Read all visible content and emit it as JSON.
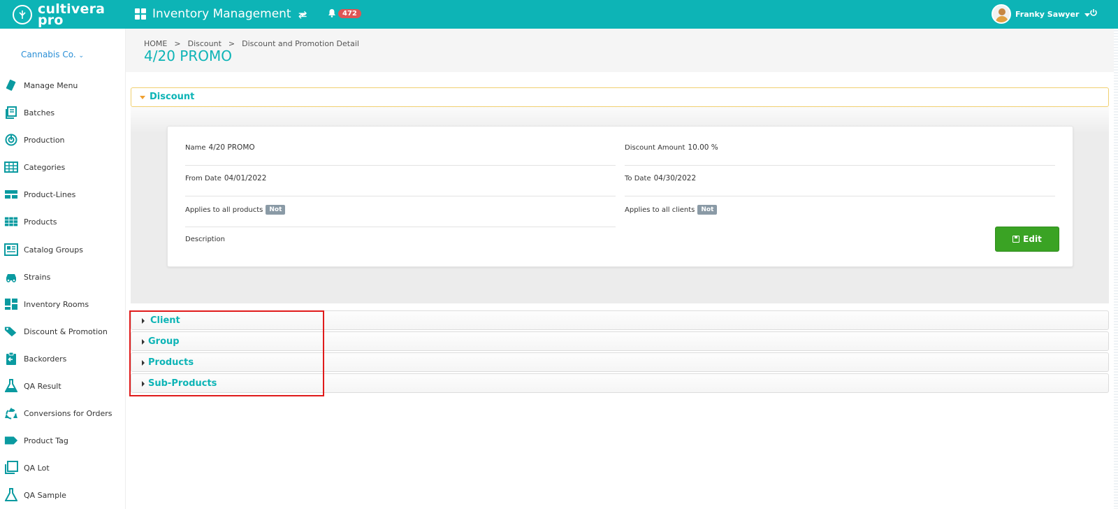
{
  "topbar": {
    "brand_line1": "cultivera",
    "brand_line2": "pro",
    "app_title": "Inventory Management",
    "notification_count": "472",
    "user_name": "Franky Sawyer",
    "accent": "#0db4b6"
  },
  "sidebar": {
    "company": "Cannabis Co.",
    "items": [
      {
        "label": "Manage Menu",
        "icon": "tag-tilted-icon"
      },
      {
        "label": "Batches",
        "icon": "batches-icon"
      },
      {
        "label": "Production",
        "icon": "production-icon"
      },
      {
        "label": "Categories",
        "icon": "table-icon"
      },
      {
        "label": "Product-Lines",
        "icon": "product-lines-icon"
      },
      {
        "label": "Products",
        "icon": "grid-icon"
      },
      {
        "label": "Catalog Groups",
        "icon": "catalog-icon"
      },
      {
        "label": "Strains",
        "icon": "strains-icon"
      },
      {
        "label": "Inventory Rooms",
        "icon": "rooms-icon"
      },
      {
        "label": "Discount & Promotion",
        "icon": "tags-icon"
      },
      {
        "label": "Backorders",
        "icon": "backorders-icon"
      },
      {
        "label": "QA Result",
        "icon": "flask-icon"
      },
      {
        "label": "Conversions for Orders",
        "icon": "recycle-icon"
      },
      {
        "label": "Product Tag",
        "icon": "tag-icon"
      },
      {
        "label": "QA Lot",
        "icon": "copy-icon"
      },
      {
        "label": "QA Sample",
        "icon": "flask-outline-icon"
      }
    ]
  },
  "breadcrumb": {
    "home": "HOME",
    "sep": ">",
    "level1": "Discount",
    "level2": "Discount and Promotion Detail"
  },
  "page": {
    "title": "4/20 PROMO"
  },
  "discount_panel": {
    "title": "Discount",
    "name_label": "Name",
    "name_value": "4/20 PROMO",
    "amount_label": "Discount Amount",
    "amount_value": "10.00 %",
    "from_label": "From Date",
    "from_value": "04/01/2022",
    "to_label": "To Date",
    "to_value": "04/30/2022",
    "applies_products_label": "Applies to all products",
    "applies_products_value": "Not",
    "applies_clients_label": "Applies to all clients",
    "applies_clients_value": "Not",
    "description_label": "Description",
    "edit_label": "Edit"
  },
  "sections": [
    {
      "title": "Client"
    },
    {
      "title": "Group"
    },
    {
      "title": "Products"
    },
    {
      "title": "Sub-Products"
    }
  ]
}
